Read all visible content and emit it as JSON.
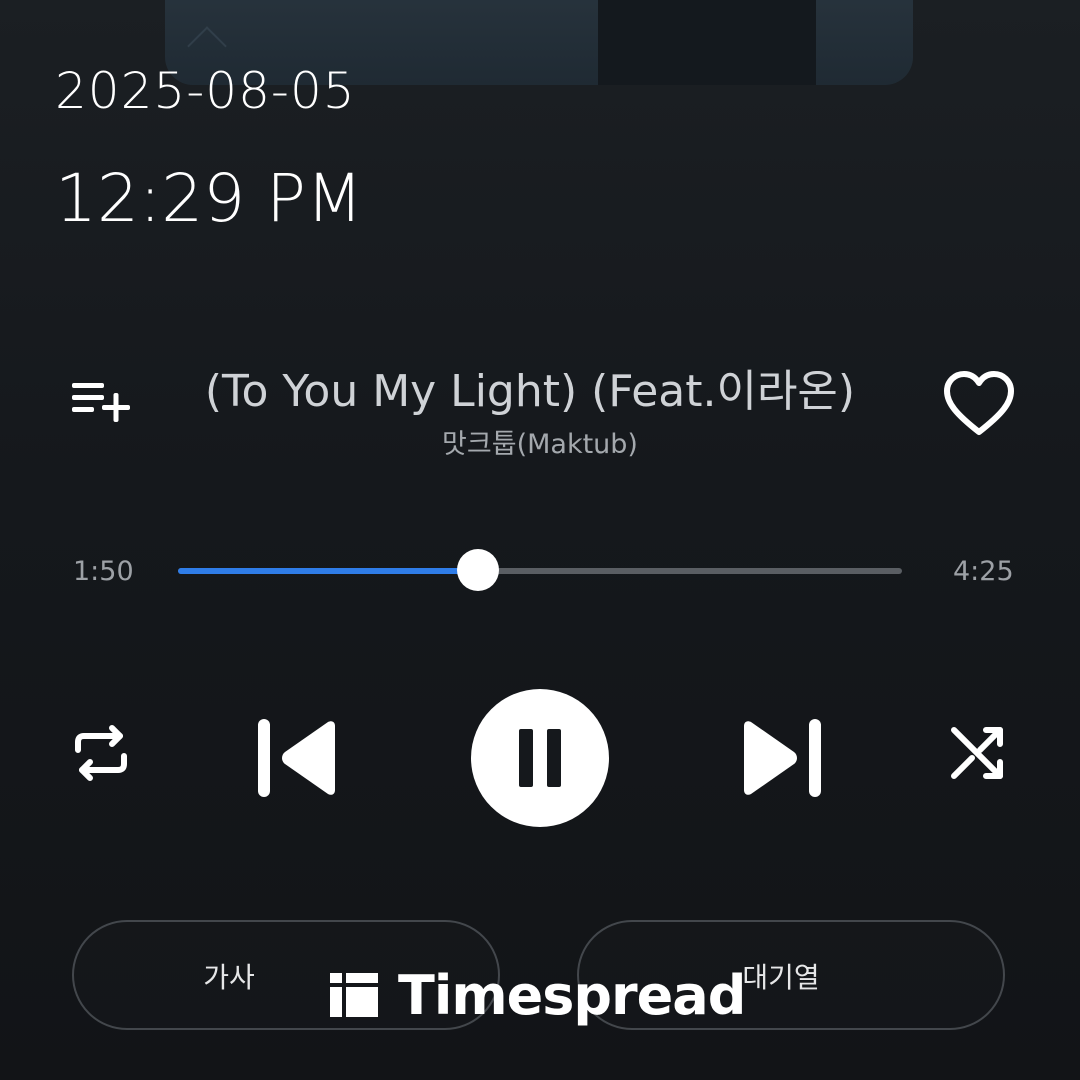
{
  "status": {
    "date": "2025-08-05",
    "time": "12:29 PM"
  },
  "track": {
    "title": "(To You My Light) (Feat.이라온)",
    "artist": "맛크툽(Maktub)"
  },
  "playback": {
    "elapsed": "1:50",
    "total": "4:25",
    "progress": 0.415,
    "state": "playing"
  },
  "actions": {
    "left_label": "가사",
    "right_label": "대기열"
  },
  "watermark": {
    "text": "Timespread"
  },
  "icons": {
    "add_to_playlist": "playlist-add-icon",
    "favorite": "heart-icon",
    "repeat": "repeat-icon",
    "previous": "skip-previous-icon",
    "pause": "pause-icon",
    "next": "skip-next-icon",
    "shuffle": "shuffle-icon",
    "watermark_logo": "timespread-logo-icon"
  },
  "colors": {
    "accent": "#2f7de8",
    "background": "#15181c",
    "track": "#5a5e63"
  }
}
